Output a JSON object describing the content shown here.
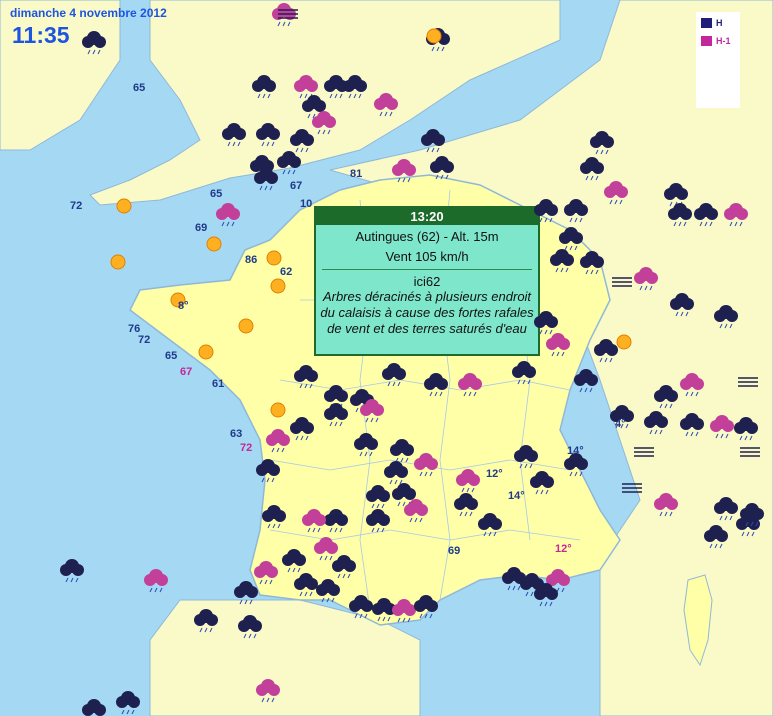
{
  "header": {
    "date": "dimanche 4 novembre 2012",
    "time": "11:35"
  },
  "legend": [
    {
      "label": "H",
      "color": "#1f1f7a"
    },
    {
      "label": "H-1",
      "color": "#c2289a"
    }
  ],
  "popup": {
    "time": "13:20",
    "location": "Autingues (62) - Alt. 15m",
    "wind": "Vent 105 km/h",
    "user": "ici62",
    "message": "Arbres déracinés à plusieurs endroit du calaisis à cause des fortes rafales de vent et des terres saturés d'eau"
  },
  "wind_labels": [
    {
      "text": "65",
      "color": "#1f3a8a"
    },
    {
      "text": "72",
      "color": "#1f3a8a"
    },
    {
      "text": "65",
      "color": "#1f3a8a"
    },
    {
      "text": "67",
      "color": "#1f3a8a"
    },
    {
      "text": "81",
      "color": "#1f3a8a"
    },
    {
      "text": "10",
      "color": "#1f3a8a"
    },
    {
      "text": "69",
      "color": "#1f3a8a"
    },
    {
      "text": "86",
      "color": "#1f3a8a"
    },
    {
      "text": "62",
      "color": "#1f3a8a"
    },
    {
      "text": "76",
      "color": "#1f3a8a"
    },
    {
      "text": "72",
      "color": "#1f3a8a"
    },
    {
      "text": "65",
      "color": "#1f3a8a"
    },
    {
      "text": "67",
      "color": "#c2289a"
    },
    {
      "text": "61",
      "color": "#1f3a8a"
    },
    {
      "text": "63",
      "color": "#1f3a8a"
    },
    {
      "text": "72",
      "color": "#c2289a"
    },
    {
      "text": "69",
      "color": "#1f3a8a"
    }
  ],
  "temperature_labels": [
    {
      "text": "8°",
      "color": "#1f3a8a"
    },
    {
      "text": "4°",
      "color": "#1f3a8a"
    },
    {
      "text": "14°",
      "color": "#1f3a8a"
    },
    {
      "text": "12°",
      "color": "#1f3a8a"
    },
    {
      "text": "14°",
      "color": "#1f3a8a"
    },
    {
      "text": "12°",
      "color": "#c2289a"
    }
  ],
  "colors": {
    "sea": "#a5d8f2",
    "land_france": "#ffffa8",
    "land_other": "#fafac8",
    "border": "#8fb8d8"
  }
}
